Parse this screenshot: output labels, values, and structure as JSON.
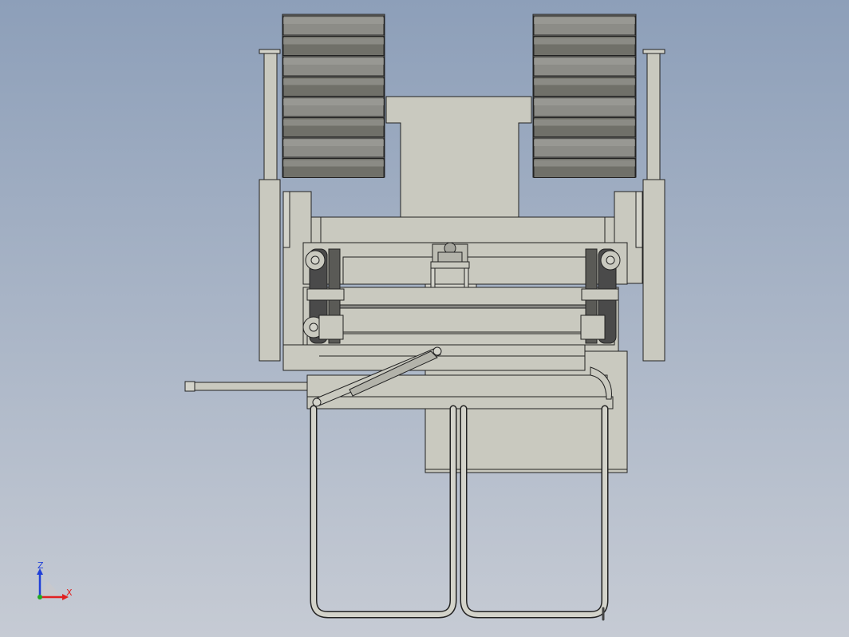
{
  "view": {
    "background_top": "#8d9fb9",
    "background_bottom": "#c6cbd4"
  },
  "model": {
    "part_fill": "#c9c9bf",
    "part_fill_light": "#d3d3ca",
    "edge_color": "#2a2a2a",
    "track_dark": "#6e6e6a",
    "track_mid": "#8a8a85",
    "arm_dark": "#4a4a4a"
  },
  "triad": {
    "z_label": "Z",
    "x_label": "X",
    "z_color": "#1f3fd8",
    "x_color": "#e02020",
    "y_color": "#22aa22"
  }
}
